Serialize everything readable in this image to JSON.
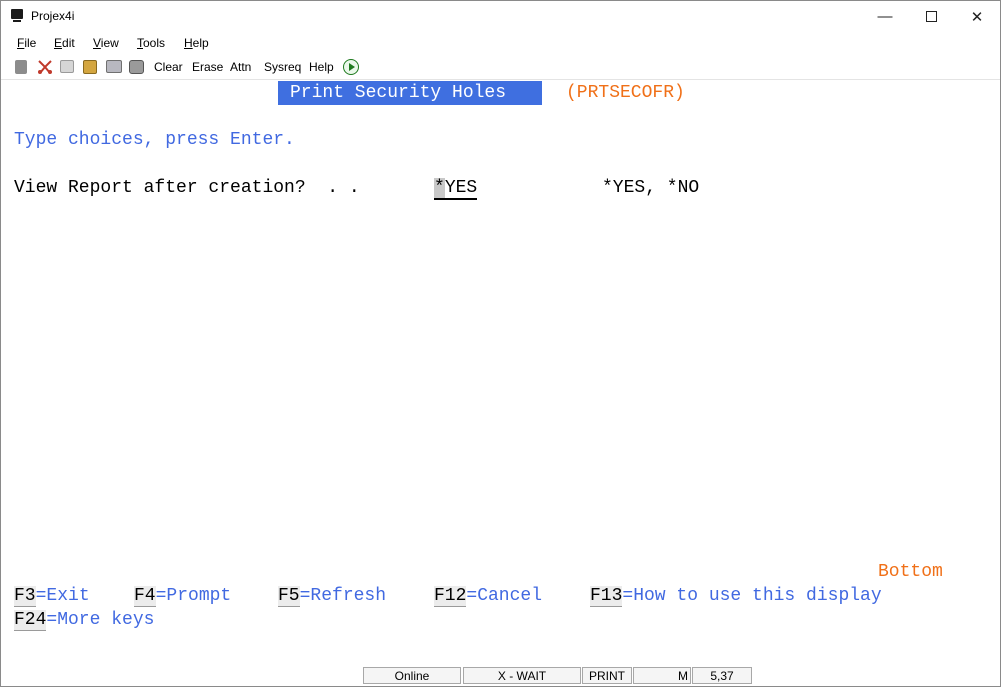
{
  "window": {
    "title": "Projex4i"
  },
  "window_controls": {
    "minimize": "—",
    "close": "✕"
  },
  "menu": [
    {
      "mnemonic": "F",
      "rest": "ile"
    },
    {
      "mnemonic": "E",
      "rest": "dit"
    },
    {
      "mnemonic": "V",
      "rest": "iew"
    },
    {
      "mnemonic": "T",
      "rest": "ools"
    },
    {
      "mnemonic": "H",
      "rest": "elp"
    }
  ],
  "toolbar": {
    "icons": [
      "print-icon",
      "cut-icon",
      "copy-icon",
      "paste-icon",
      "printer-icon",
      "camera-icon"
    ],
    "buttons": [
      "Clear",
      "Erase",
      "Attn",
      "Sysreq",
      "Help"
    ],
    "run_icon": "play-icon"
  },
  "screen": {
    "title": "Print Security Holes",
    "command": "(PRTSECOFR)",
    "instruction": "Type choices, press Enter.",
    "prompt_label": "View Report after creation?  . .",
    "field_cursor_char": "*",
    "field_rest": "YES",
    "allowed_values": "*YES, *NO",
    "more_indicator": "Bottom",
    "fkeys": [
      {
        "key": "F3",
        "action": "=Exit"
      },
      {
        "key": "F4",
        "action": "=Prompt"
      },
      {
        "key": "F5",
        "action": "=Refresh"
      },
      {
        "key": "F12",
        "action": "=Cancel"
      },
      {
        "key": "F13",
        "action": "=How to use this display"
      },
      {
        "key": "F24",
        "action": "=More keys"
      }
    ]
  },
  "status": {
    "connection": "Online",
    "wait": "X - WAIT",
    "print": "PRINT",
    "mode": "M",
    "cursor_pos": "5,37"
  },
  "colors": {
    "field_text": "#4169e1",
    "title_bg": "#3f6fe0",
    "highlight": "#f07018"
  }
}
